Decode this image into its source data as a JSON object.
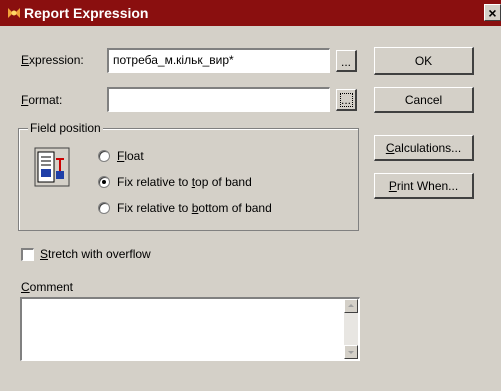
{
  "window": {
    "title": "Report Expression",
    "close_glyph": "×"
  },
  "expression": {
    "label_hot": "E",
    "label_rest": "xpression:",
    "value": "потреба_м.кільк_вир*",
    "browse_label": "..."
  },
  "format": {
    "label_hot": "F",
    "label_rest": "ormat:",
    "value": "",
    "browse_label": "..."
  },
  "field_position": {
    "title": "Field position",
    "options": [
      {
        "pre": "",
        "hot": "F",
        "post": "loat",
        "selected": false
      },
      {
        "pre": "Fix relative to ",
        "hot": "t",
        "post": "op of band",
        "selected": true
      },
      {
        "pre": "Fix relative to ",
        "hot": "b",
        "post": "ottom of band",
        "selected": false
      }
    ]
  },
  "buttons": {
    "ok": "OK",
    "cancel": "Cancel",
    "calculations": {
      "hot": "C",
      "rest": "alculations..."
    },
    "print_when": {
      "hot": "P",
      "rest": "rint When..."
    }
  },
  "stretch": {
    "hot": "S",
    "rest": "tretch with overflow",
    "checked": false
  },
  "comment": {
    "label_hot": "C",
    "label_rest": "omment",
    "value": ""
  },
  "icons": [
    "report-expression-icon",
    "field-position-icon",
    "close-icon",
    "scroll-up-icon",
    "scroll-down-icon"
  ]
}
